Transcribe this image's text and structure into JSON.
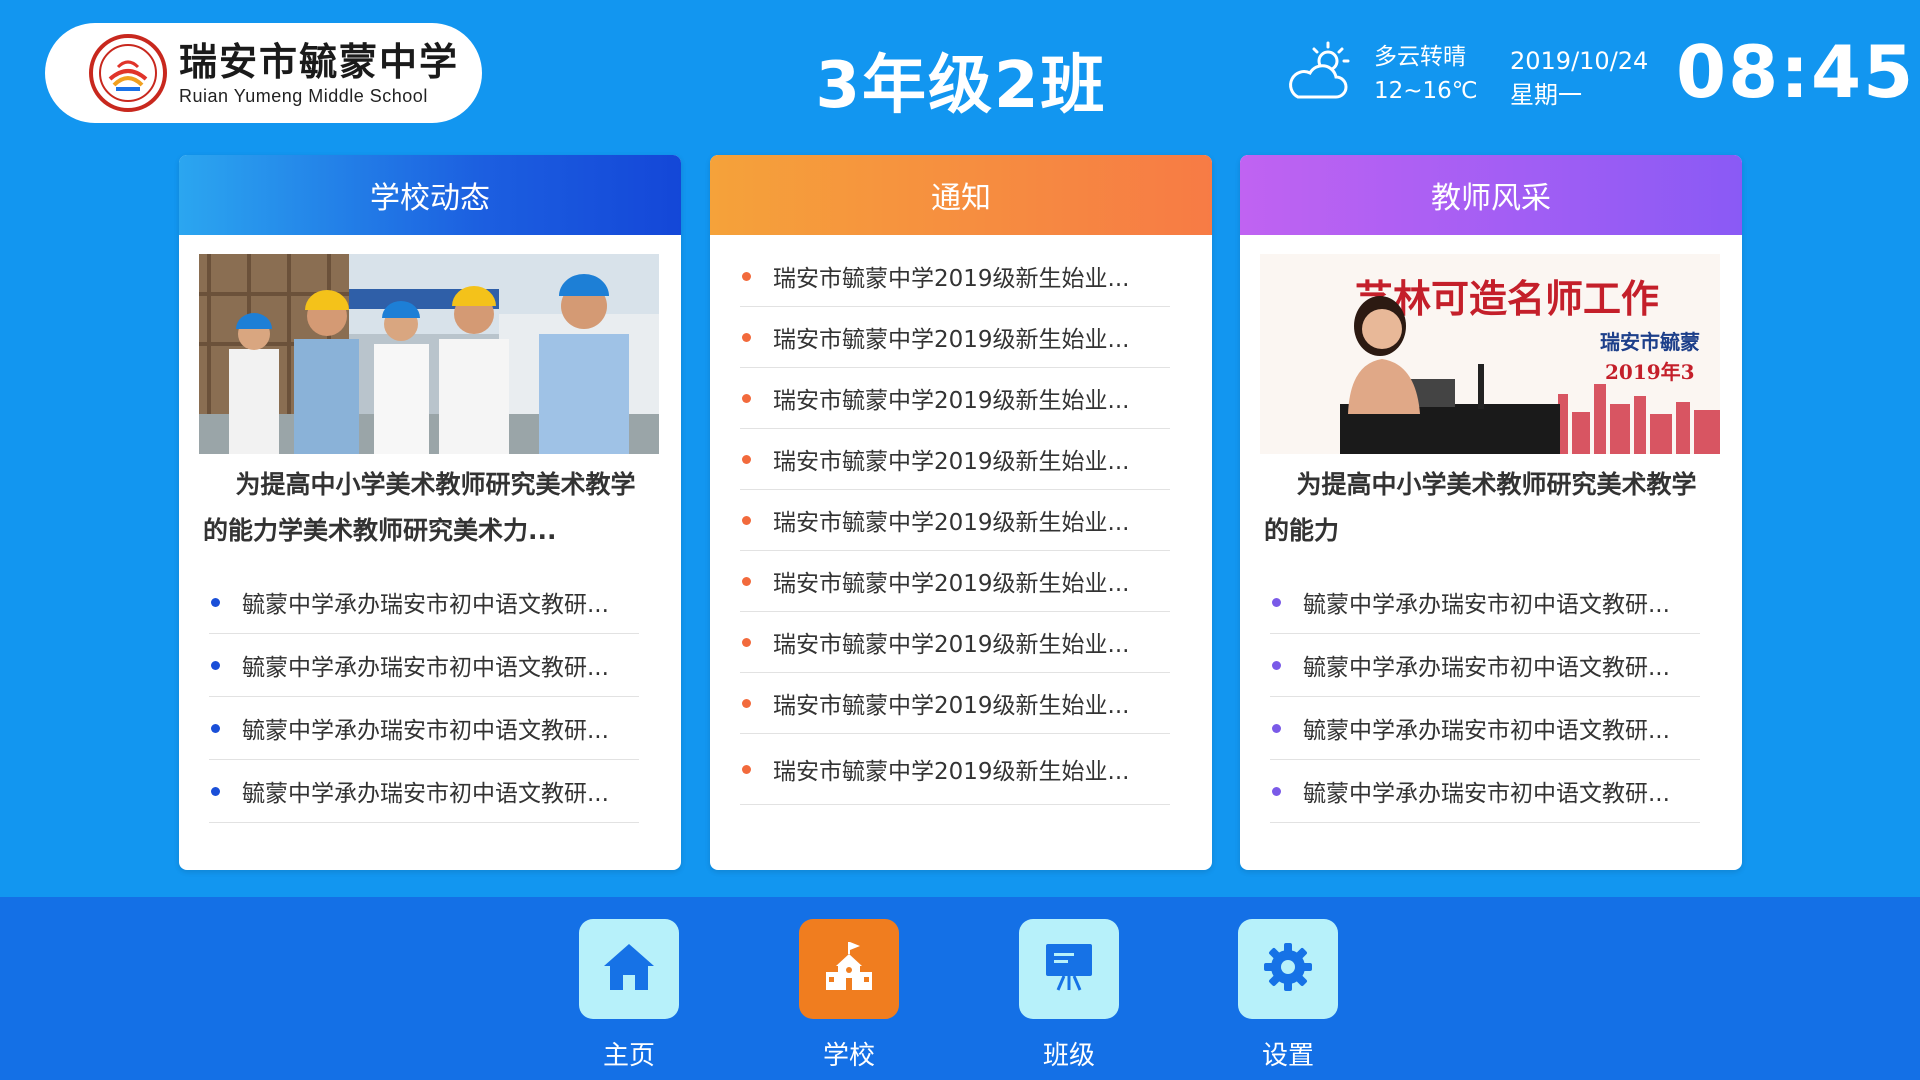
{
  "header": {
    "school_name_cn": "瑞安市毓蒙中学",
    "school_name_en": "Ruian Yumeng Middle School",
    "class_title": "3年级2班",
    "weather_icon": "partly-cloudy-icon",
    "weather_desc": "多云转晴",
    "temperature": "12~16℃",
    "date": "2019/10/24",
    "weekday": "星期一",
    "time": "08:45"
  },
  "cards": {
    "school_news": {
      "title": "学校动态",
      "featured_title": "为提高中小学美术教师研究美术教学的能力学美术教师研究美术力...",
      "items": [
        "毓蒙中学承办瑞安市初中语文教研...",
        "毓蒙中学承办瑞安市初中语文教研...",
        "毓蒙中学承办瑞安市初中语文教研...",
        "毓蒙中学承办瑞安市初中语文教研..."
      ]
    },
    "notice": {
      "title": "通知",
      "items": [
        "瑞安市毓蒙中学2019级新生始业...",
        "瑞安市毓蒙中学2019级新生始业...",
        "瑞安市毓蒙中学2019级新生始业...",
        "瑞安市毓蒙中学2019级新生始业...",
        "瑞安市毓蒙中学2019级新生始业...",
        "瑞安市毓蒙中学2019级新生始业...",
        "瑞安市毓蒙中学2019级新生始业...",
        "瑞安市毓蒙中学2019级新生始业...",
        "瑞安市毓蒙中学2019级新生始业..."
      ]
    },
    "teacher_style": {
      "title": "教师风采",
      "featured_title": "为提高中小学美术教师研究美术教学的能力",
      "banner_text_1": "艺林可造名师工作",
      "banner_text_2": "瑞安市毓蒙",
      "banner_text_3": "2019年3",
      "items": [
        "毓蒙中学承办瑞安市初中语文教研...",
        "毓蒙中学承办瑞安市初中语文教研...",
        "毓蒙中学承办瑞安市初中语文教研...",
        "毓蒙中学承办瑞安市初中语文教研..."
      ]
    }
  },
  "nav": {
    "home": "主页",
    "school": "学校",
    "class": "班级",
    "settings": "设置"
  },
  "colors": {
    "background": "#1296f0",
    "bottom_bar": "#1470e6",
    "active_tile": "#f07d1f",
    "tile": "#b7f1fa"
  }
}
